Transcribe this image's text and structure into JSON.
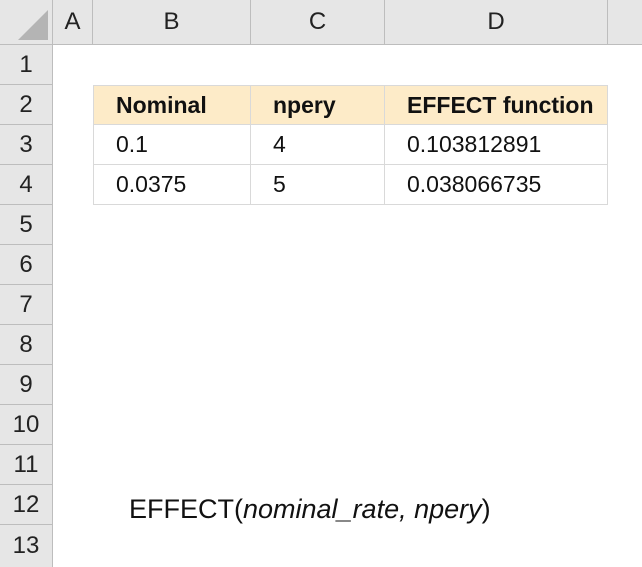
{
  "columns": [
    "A",
    "B",
    "C",
    "D"
  ],
  "rows": [
    "1",
    "2",
    "3",
    "4",
    "5",
    "6",
    "7",
    "8",
    "9",
    "10",
    "11",
    "12",
    "13"
  ],
  "table": {
    "headers": [
      "Nominal",
      "npery",
      "EFFECT function"
    ],
    "rows": [
      [
        "0.1",
        "4",
        "0.103812891"
      ],
      [
        "0.0375",
        "5",
        "0.038066735"
      ]
    ]
  },
  "formula": {
    "name": "EFFECT(",
    "args": "nominal_rate, npery",
    "close": " )"
  },
  "colors": {
    "header_fill": "#fdebc8",
    "grid": "#d9d9d9",
    "heading_bg": "#e6e6e6"
  }
}
